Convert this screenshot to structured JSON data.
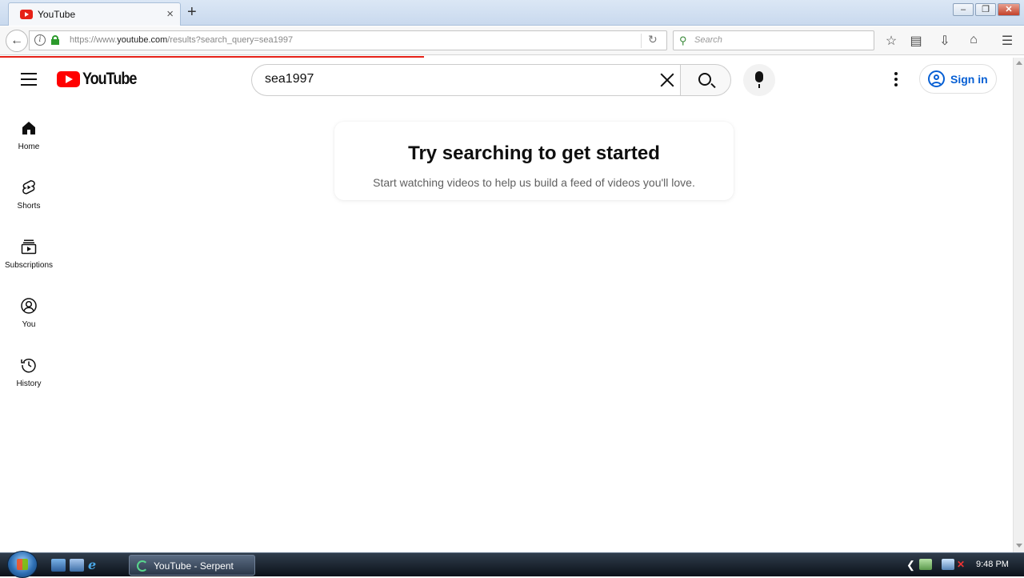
{
  "browser": {
    "tab_title": "YouTube",
    "tab_close": "×",
    "new_tab": "+",
    "url_prefix": "https://www.",
    "url_host": "youtube.com",
    "url_path": "/results?search_query=sea1997",
    "search_placeholder": "Search",
    "window_controls": {
      "minimize": "–",
      "maximize": "❐",
      "close": "✕"
    }
  },
  "header": {
    "logo_text": "YouTube",
    "search_value": "sea1997",
    "sign_in_label": "Sign in"
  },
  "sidebar": {
    "items": [
      {
        "label": "Home",
        "icon": "home-icon"
      },
      {
        "label": "Shorts",
        "icon": "shorts-icon"
      },
      {
        "label": "Subscriptions",
        "icon": "subscriptions-icon"
      },
      {
        "label": "You",
        "icon": "you-icon"
      },
      {
        "label": "History",
        "icon": "history-icon"
      }
    ]
  },
  "main": {
    "empty_title": "Try searching to get started",
    "empty_subtitle": "Start watching videos to help us build a feed of videos you'll love."
  },
  "taskbar": {
    "task_label": "YouTube - Serpent",
    "clock": "9:48 PM"
  },
  "colors": {
    "brand_red": "#ff0000",
    "link_blue": "#065fd4",
    "progress_red": "#e62117"
  }
}
